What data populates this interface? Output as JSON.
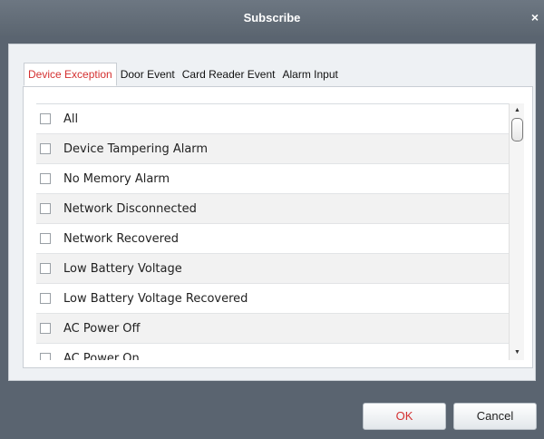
{
  "dialog": {
    "title": "Subscribe",
    "close_glyph": "×"
  },
  "tabs": [
    {
      "label": "Device Exception",
      "active": true
    },
    {
      "label": "Door Event",
      "active": false
    },
    {
      "label": "Card Reader Event",
      "active": false
    },
    {
      "label": "Alarm Input",
      "active": false
    }
  ],
  "events": [
    {
      "label": "All",
      "checked": false
    },
    {
      "label": "Device Tampering Alarm",
      "checked": false
    },
    {
      "label": "No Memory Alarm",
      "checked": false
    },
    {
      "label": "Network Disconnected",
      "checked": false
    },
    {
      "label": "Network Recovered",
      "checked": false
    },
    {
      "label": "Low Battery Voltage",
      "checked": false
    },
    {
      "label": "Low Battery Voltage Recovered",
      "checked": false
    },
    {
      "label": "AC Power Off",
      "checked": false
    },
    {
      "label": "AC Power On",
      "checked": false
    }
  ],
  "scrollbar": {
    "up_glyph": "▲",
    "down_glyph": "▼"
  },
  "buttons": {
    "ok": "OK",
    "cancel": "Cancel"
  },
  "colors": {
    "accent": "#d43030",
    "frame": "#5a6470",
    "panel": "#eef1f4"
  }
}
